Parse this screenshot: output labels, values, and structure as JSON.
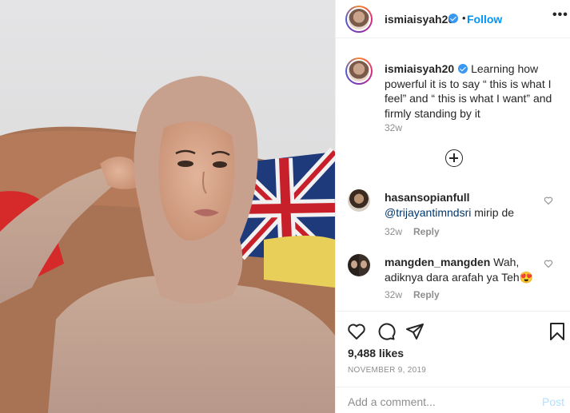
{
  "post": {
    "author": "ismiaisyah20",
    "follow_label": "Follow",
    "separator": "•",
    "more_label": "•••",
    "caption": "Learning how powerful it is to say “ this is what I feel” and “ this is what I want” and firmly standing by it",
    "caption_time": "32w",
    "likes": "9,488 likes",
    "date": "NOVEMBER 9, 2019"
  },
  "comments": [
    {
      "username": "hasansopianfull",
      "mention": "@trijayantimndsri",
      "text": " mirip de",
      "time": "32w",
      "reply_label": "Reply"
    },
    {
      "username": "mangden_mangden",
      "text": " Wah, adiknya dara arafah ya Teh",
      "emoji": "😍",
      "time": "32w",
      "reply_label": "Reply"
    }
  ],
  "composer": {
    "placeholder": "Add a comment...",
    "post_label": "Post"
  },
  "colors": {
    "accent": "#0095f6",
    "verified": "#3897f0",
    "muted": "#8e8e8e",
    "post_disabled": "#b2dffc"
  },
  "icons": [
    "verified-badge-icon",
    "more-options-icon",
    "load-more-comments-icon",
    "heart-icon",
    "comment-icon",
    "share-icon",
    "bookmark-icon"
  ]
}
